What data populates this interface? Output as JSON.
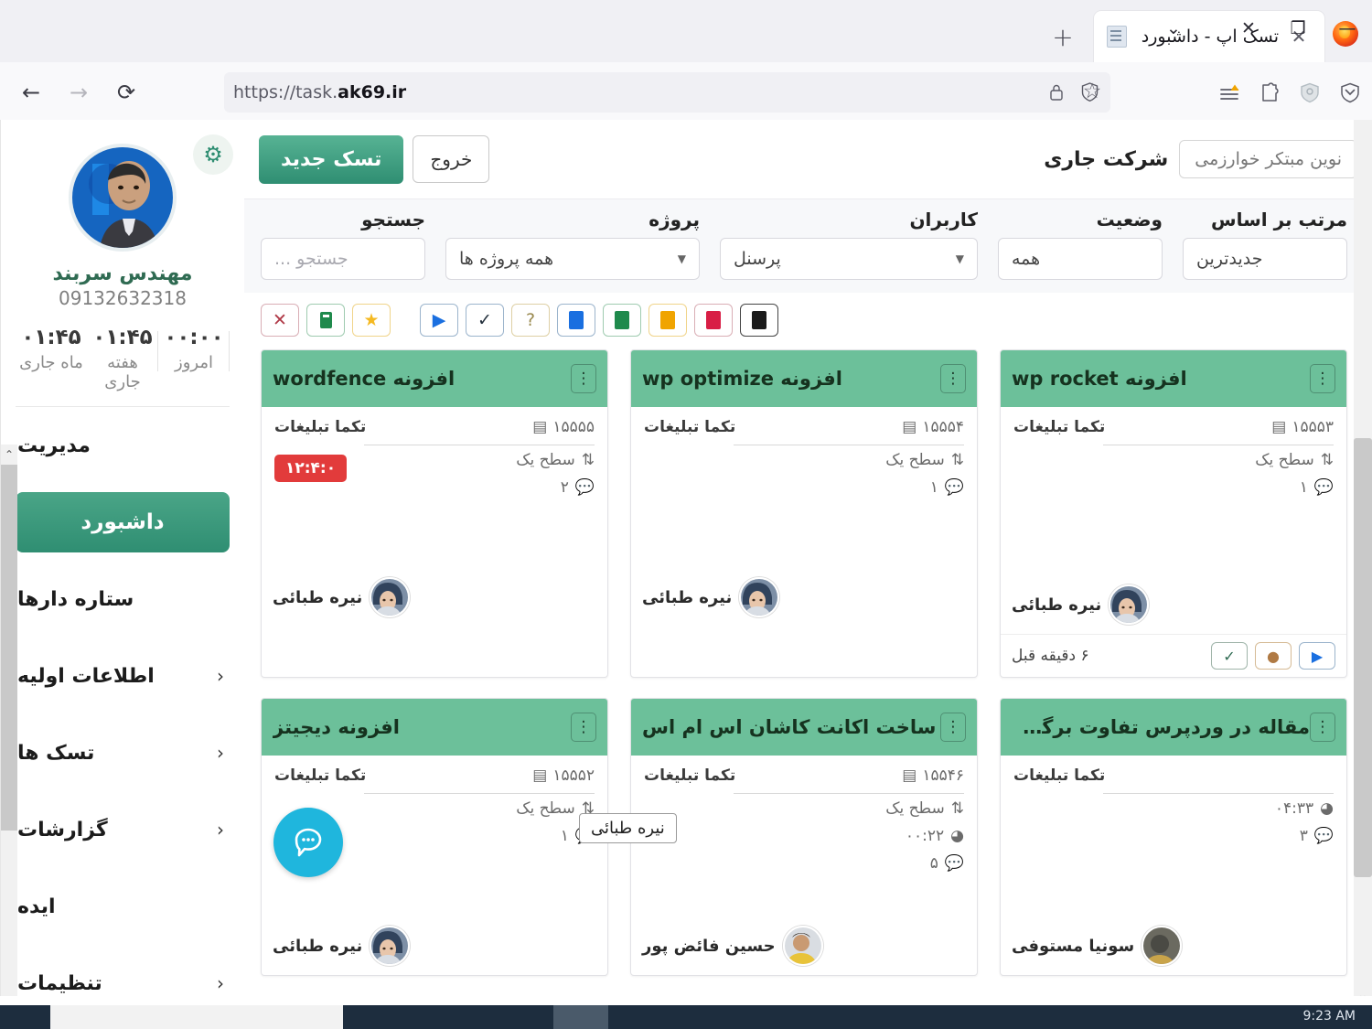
{
  "browser": {
    "tab_title": "تسک اپ - داشبورد",
    "favicon_name": "document-favicon",
    "close_tab_label": "✕",
    "new_tab_label": "+",
    "list_all_tabs_label": "⌄",
    "minimize_label": "—",
    "maximize_label": "❐",
    "close_window_label": "✕",
    "back_label": "←",
    "forward_label": "→",
    "reload_label": "⟳",
    "url_prefix": "https://task.",
    "url_domain": "ak69.ir",
    "shield_icon": "shield-icon",
    "lock_icon": "lock-icon",
    "bookmark_star": "☆",
    "pocket_icon": "pocket-icon",
    "tracking_icon": "tracking-shield-icon",
    "extensions_icon": "extensions-icon",
    "menu_icon": "hamburger-menu-icon"
  },
  "topbar": {
    "company_label": "شرکت جاری",
    "company_value": "نوین مبتکر خوارزمی",
    "new_task_label": "تسک جدید",
    "exit_label": "خروج"
  },
  "filters": [
    {
      "label": "جستجو",
      "value": "جستجو ...",
      "placeholder": true,
      "caret": false,
      "w": "w-search"
    },
    {
      "label": "پروژه",
      "value": "همه پروژه ها",
      "placeholder": false,
      "caret": true,
      "w": "w-proj"
    },
    {
      "label": "کاربران",
      "value": "پرسنل",
      "placeholder": false,
      "caret": true,
      "w": "w-users"
    },
    {
      "label": "وضعیت",
      "value": "همه",
      "placeholder": false,
      "caret": false,
      "w": "w-status"
    },
    {
      "label": "مرتب بر اساس",
      "value": "جدیدترین",
      "placeholder": false,
      "caret": false,
      "w": "w-sort"
    }
  ],
  "chips": [
    {
      "name": "clear-filter-chip",
      "glyph": "✕",
      "color": "#b03a48",
      "border": "#d9aeb5",
      "type": "glyph",
      "gap": false
    },
    {
      "name": "archive-chip",
      "glyph": "▉",
      "color": "#1f8a4c",
      "border": "#9fcbb0",
      "type": "doc",
      "gap": false
    },
    {
      "name": "star-filter-chip",
      "glyph": "★",
      "color": "#f5b921",
      "border": "#f0d48a",
      "type": "glyph",
      "gap": true
    },
    {
      "name": "play-filter-chip",
      "glyph": "▶",
      "color": "#1a6fe0",
      "border": "#9bb4cc",
      "type": "glyph",
      "gap": false
    },
    {
      "name": "done-filter-chip",
      "glyph": "✓",
      "color": "#23303c",
      "border": "#9bb4cc",
      "type": "glyph",
      "gap": false
    },
    {
      "name": "unknown-filter-chip",
      "glyph": "?",
      "color": "#9a8a50",
      "border": "#ded0a5",
      "type": "glyph",
      "gap": false
    },
    {
      "name": "blue-label-chip",
      "glyph": "",
      "color": "#1a6fe0",
      "border": "#9bb4cc",
      "type": "sq",
      "gap": false
    },
    {
      "name": "green-label-chip",
      "glyph": "",
      "color": "#1f8a4c",
      "border": "#9fcbb0",
      "type": "sq",
      "gap": false
    },
    {
      "name": "orange-label-chip",
      "glyph": "",
      "color": "#f0a400",
      "border": "#f0d48a",
      "type": "sq",
      "gap": false
    },
    {
      "name": "red-label-chip",
      "glyph": "",
      "color": "#d81e45",
      "border": "#d9aeb5",
      "type": "sq",
      "gap": false
    },
    {
      "name": "black-label-chip",
      "glyph": "",
      "color": "#1b1b1b",
      "border": "#444",
      "type": "sq",
      "gap": false
    }
  ],
  "cards": [
    {
      "title": "افزونه wordfence",
      "project": "تکما تبلیغات",
      "id": "۱۵۵۵۵",
      "level": "سطح یک",
      "comments": "۲",
      "timer": "۱۲:۴:۰",
      "has_timer": true,
      "duration": "",
      "has_duration": false,
      "assignee": "نیره طبائی",
      "avatar": "female-1",
      "has_footer": false,
      "foot_time": "",
      "short_body": false
    },
    {
      "title": "افزونه wp optimize",
      "project": "تکما تبلیغات",
      "id": "۱۵۵۵۴",
      "level": "سطح یک",
      "comments": "۱",
      "timer": "",
      "has_timer": false,
      "duration": "",
      "has_duration": false,
      "assignee": "نیره طبائی",
      "avatar": "female-1",
      "has_footer": false,
      "foot_time": "",
      "short_body": false
    },
    {
      "title": "افزونه wp rocket",
      "project": "تکما تبلیغات",
      "id": "۱۵۵۵۳",
      "level": "سطح یک",
      "comments": "۱",
      "timer": "",
      "has_timer": false,
      "duration": "",
      "has_duration": false,
      "assignee": "نیره طبائی",
      "avatar": "female-1",
      "has_footer": true,
      "foot_time": "۶ دقیقه قبل",
      "short_body": true
    },
    {
      "title": "افزونه دیجیتز",
      "project": "تکما تبلیغات",
      "id": "۱۵۵۵۲",
      "level": "سطح یک",
      "comments": "۱",
      "timer": "",
      "has_timer": false,
      "duration": "",
      "has_duration": false,
      "assignee": "نیره طبائی",
      "avatar": "female-1",
      "has_footer": false,
      "foot_time": "",
      "short_body": false
    },
    {
      "title": "ساخت اکانت کاشان اس ام اس",
      "project": "تکما تبلیغات",
      "id": "۱۵۵۴۶",
      "level": "سطح یک",
      "comments": "۵",
      "timer": "",
      "has_timer": false,
      "duration": "۰۰:۲۲",
      "has_duration": true,
      "assignee": "حسین فائض پور",
      "avatar": "male-1",
      "has_footer": false,
      "foot_time": "",
      "short_body": false
    },
    {
      "title": "مقاله در وردپرس تفاوت برگه و ن ...",
      "project": "تکما تبلیغات",
      "id": "",
      "level": "",
      "comments": "۳",
      "timer": "",
      "has_timer": false,
      "duration": "۰۴:۳۳",
      "has_duration": true,
      "assignee": "سونیا مستوفی",
      "avatar": "female-2",
      "has_footer": false,
      "foot_time": "",
      "short_body": false
    }
  ],
  "card_foot_actions": [
    {
      "name": "approve-task-button",
      "glyph": "✓",
      "color": "#2f6b52",
      "border": "#9fb4a9"
    },
    {
      "name": "comment-task-button",
      "glyph": "●",
      "color": "#b07a44",
      "border": "#d6bb96"
    },
    {
      "name": "start-timer-button",
      "glyph": "▶",
      "color": "#1a6fe0",
      "border": "#9bb4cc"
    }
  ],
  "tooltip": {
    "text": "نیره طبائی"
  },
  "chat_widget": {
    "name": "chat-bubble-widget",
    "color": "#1fb6dd"
  },
  "sidebar": {
    "gear_label": "⚙",
    "user_name": "مهندس سربند",
    "user_phone": "09132632318",
    "stats": [
      {
        "value": "۰۱:۴۵",
        "label": "ماه جاری"
      },
      {
        "value": "۰۱:۴۵",
        "label": "هفته جاری"
      },
      {
        "value": "۰۰:۰۰",
        "label": "امروز"
      }
    ],
    "menu": [
      {
        "label": "مدیریت",
        "active": false,
        "chevron": false
      },
      {
        "label": "داشبورد",
        "active": true,
        "chevron": false
      },
      {
        "label": "ستاره دارها",
        "active": false,
        "chevron": false
      },
      {
        "label": "اطلاعات اولیه",
        "active": false,
        "chevron": true
      },
      {
        "label": "تسک ها",
        "active": false,
        "chevron": true
      },
      {
        "label": "گزارشات",
        "active": false,
        "chevron": true
      },
      {
        "label": "ایده",
        "active": false,
        "chevron": false
      },
      {
        "label": "تنظیمات",
        "active": false,
        "chevron": true
      }
    ],
    "chevron_glyph": "‹",
    "scroll_up": "⌃",
    "scroll_down": "⌄"
  },
  "taskbar": {
    "clock": "9:23 AM"
  }
}
